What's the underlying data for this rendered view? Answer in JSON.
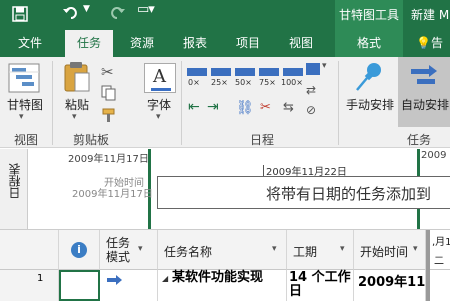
{
  "titlebar": {
    "save_icon": "save-icon",
    "undo_icon": "undo-icon",
    "redo_icon": "redo-icon",
    "qa_more_icon": "chevron-down-icon",
    "context_tools": "甘特图工具",
    "window_title": "新建 M"
  },
  "tabs": [
    {
      "label": "文件"
    },
    {
      "label": "任务"
    },
    {
      "label": "资源"
    },
    {
      "label": "报表"
    },
    {
      "label": "项目"
    },
    {
      "label": "视图"
    },
    {
      "label": "格式"
    }
  ],
  "tellme": "告",
  "ribbon": {
    "gantt_label": "甘特图",
    "paste_label": "粘贴",
    "font_label": "字体",
    "manual_schedule_label": "手动安排",
    "auto_schedule_label": "自动安排",
    "progress_buttons": [
      "0×",
      "25×",
      "50×",
      "75×",
      "100×"
    ],
    "groups": {
      "view": "视图",
      "clipboard": "剪贴板",
      "schedule": "日程",
      "tasks": "任务"
    },
    "colors": {
      "accent": "#217346",
      "pin": "#3a9ad9"
    }
  },
  "timeline": {
    "side_label": "日程表",
    "date_start_top": "2009年11月17日",
    "start_label": "开始时间",
    "date_start_side": "2009年11月17日",
    "date_mid": "2009年11月22日",
    "date_right": "2009",
    "placeholder": "将带有日期的任务添加到"
  },
  "grid": {
    "columns": {
      "info_icon": "info-icon",
      "mode": "任务模式",
      "name": "任务名称",
      "duration": "工期",
      "start": "开始时间",
      "next_top": ",月1",
      "next_bottom": "二"
    },
    "rows": [
      {
        "id": "1",
        "name": "某软件功能实现",
        "duration": "14 个工作日",
        "start": "2009年11"
      }
    ]
  }
}
